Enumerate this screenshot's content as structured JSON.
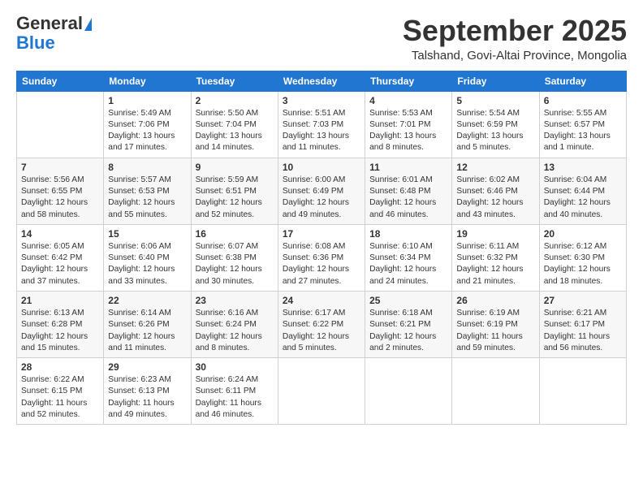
{
  "logo": {
    "general": "General",
    "blue": "Blue"
  },
  "title": "September 2025",
  "location": "Talshand, Govi-Altai Province, Mongolia",
  "days_of_week": [
    "Sunday",
    "Monday",
    "Tuesday",
    "Wednesday",
    "Thursday",
    "Friday",
    "Saturday"
  ],
  "weeks": [
    [
      {
        "day": "",
        "info": ""
      },
      {
        "day": "1",
        "info": "Sunrise: 5:49 AM\nSunset: 7:06 PM\nDaylight: 13 hours\nand 17 minutes."
      },
      {
        "day": "2",
        "info": "Sunrise: 5:50 AM\nSunset: 7:04 PM\nDaylight: 13 hours\nand 14 minutes."
      },
      {
        "day": "3",
        "info": "Sunrise: 5:51 AM\nSunset: 7:03 PM\nDaylight: 13 hours\nand 11 minutes."
      },
      {
        "day": "4",
        "info": "Sunrise: 5:53 AM\nSunset: 7:01 PM\nDaylight: 13 hours\nand 8 minutes."
      },
      {
        "day": "5",
        "info": "Sunrise: 5:54 AM\nSunset: 6:59 PM\nDaylight: 13 hours\nand 5 minutes."
      },
      {
        "day": "6",
        "info": "Sunrise: 5:55 AM\nSunset: 6:57 PM\nDaylight: 13 hours\nand 1 minute."
      }
    ],
    [
      {
        "day": "7",
        "info": "Sunrise: 5:56 AM\nSunset: 6:55 PM\nDaylight: 12 hours\nand 58 minutes."
      },
      {
        "day": "8",
        "info": "Sunrise: 5:57 AM\nSunset: 6:53 PM\nDaylight: 12 hours\nand 55 minutes."
      },
      {
        "day": "9",
        "info": "Sunrise: 5:59 AM\nSunset: 6:51 PM\nDaylight: 12 hours\nand 52 minutes."
      },
      {
        "day": "10",
        "info": "Sunrise: 6:00 AM\nSunset: 6:49 PM\nDaylight: 12 hours\nand 49 minutes."
      },
      {
        "day": "11",
        "info": "Sunrise: 6:01 AM\nSunset: 6:48 PM\nDaylight: 12 hours\nand 46 minutes."
      },
      {
        "day": "12",
        "info": "Sunrise: 6:02 AM\nSunset: 6:46 PM\nDaylight: 12 hours\nand 43 minutes."
      },
      {
        "day": "13",
        "info": "Sunrise: 6:04 AM\nSunset: 6:44 PM\nDaylight: 12 hours\nand 40 minutes."
      }
    ],
    [
      {
        "day": "14",
        "info": "Sunrise: 6:05 AM\nSunset: 6:42 PM\nDaylight: 12 hours\nand 37 minutes."
      },
      {
        "day": "15",
        "info": "Sunrise: 6:06 AM\nSunset: 6:40 PM\nDaylight: 12 hours\nand 33 minutes."
      },
      {
        "day": "16",
        "info": "Sunrise: 6:07 AM\nSunset: 6:38 PM\nDaylight: 12 hours\nand 30 minutes."
      },
      {
        "day": "17",
        "info": "Sunrise: 6:08 AM\nSunset: 6:36 PM\nDaylight: 12 hours\nand 27 minutes."
      },
      {
        "day": "18",
        "info": "Sunrise: 6:10 AM\nSunset: 6:34 PM\nDaylight: 12 hours\nand 24 minutes."
      },
      {
        "day": "19",
        "info": "Sunrise: 6:11 AM\nSunset: 6:32 PM\nDaylight: 12 hours\nand 21 minutes."
      },
      {
        "day": "20",
        "info": "Sunrise: 6:12 AM\nSunset: 6:30 PM\nDaylight: 12 hours\nand 18 minutes."
      }
    ],
    [
      {
        "day": "21",
        "info": "Sunrise: 6:13 AM\nSunset: 6:28 PM\nDaylight: 12 hours\nand 15 minutes."
      },
      {
        "day": "22",
        "info": "Sunrise: 6:14 AM\nSunset: 6:26 PM\nDaylight: 12 hours\nand 11 minutes."
      },
      {
        "day": "23",
        "info": "Sunrise: 6:16 AM\nSunset: 6:24 PM\nDaylight: 12 hours\nand 8 minutes."
      },
      {
        "day": "24",
        "info": "Sunrise: 6:17 AM\nSunset: 6:22 PM\nDaylight: 12 hours\nand 5 minutes."
      },
      {
        "day": "25",
        "info": "Sunrise: 6:18 AM\nSunset: 6:21 PM\nDaylight: 12 hours\nand 2 minutes."
      },
      {
        "day": "26",
        "info": "Sunrise: 6:19 AM\nSunset: 6:19 PM\nDaylight: 11 hours\nand 59 minutes."
      },
      {
        "day": "27",
        "info": "Sunrise: 6:21 AM\nSunset: 6:17 PM\nDaylight: 11 hours\nand 56 minutes."
      }
    ],
    [
      {
        "day": "28",
        "info": "Sunrise: 6:22 AM\nSunset: 6:15 PM\nDaylight: 11 hours\nand 52 minutes."
      },
      {
        "day": "29",
        "info": "Sunrise: 6:23 AM\nSunset: 6:13 PM\nDaylight: 11 hours\nand 49 minutes."
      },
      {
        "day": "30",
        "info": "Sunrise: 6:24 AM\nSunset: 6:11 PM\nDaylight: 11 hours\nand 46 minutes."
      },
      {
        "day": "",
        "info": ""
      },
      {
        "day": "",
        "info": ""
      },
      {
        "day": "",
        "info": ""
      },
      {
        "day": "",
        "info": ""
      }
    ]
  ]
}
